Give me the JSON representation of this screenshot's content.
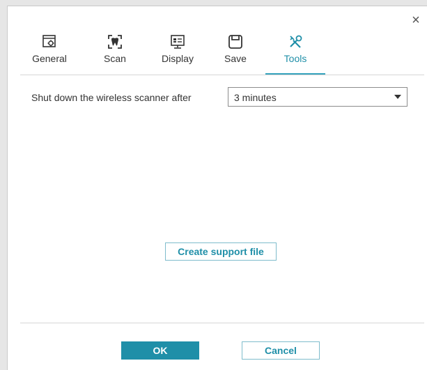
{
  "dialog": {
    "close_glyph": "×"
  },
  "tabs": [
    {
      "label": "General",
      "icon": "settings-window-icon"
    },
    {
      "label": "Scan",
      "icon": "scan-icon"
    },
    {
      "label": "Display",
      "icon": "display-icon"
    },
    {
      "label": "Save",
      "icon": "save-icon"
    },
    {
      "label": "Tools",
      "icon": "tools-icon",
      "active": true
    }
  ],
  "tools": {
    "shutdown_label": "Shut down the wireless scanner after",
    "shutdown_value": "3 minutes",
    "support_button": "Create support file"
  },
  "footer": {
    "ok_label": "OK",
    "cancel_label": "Cancel"
  },
  "colors": {
    "accent": "#1f8fa8",
    "accent_light": "#36a3bd"
  }
}
